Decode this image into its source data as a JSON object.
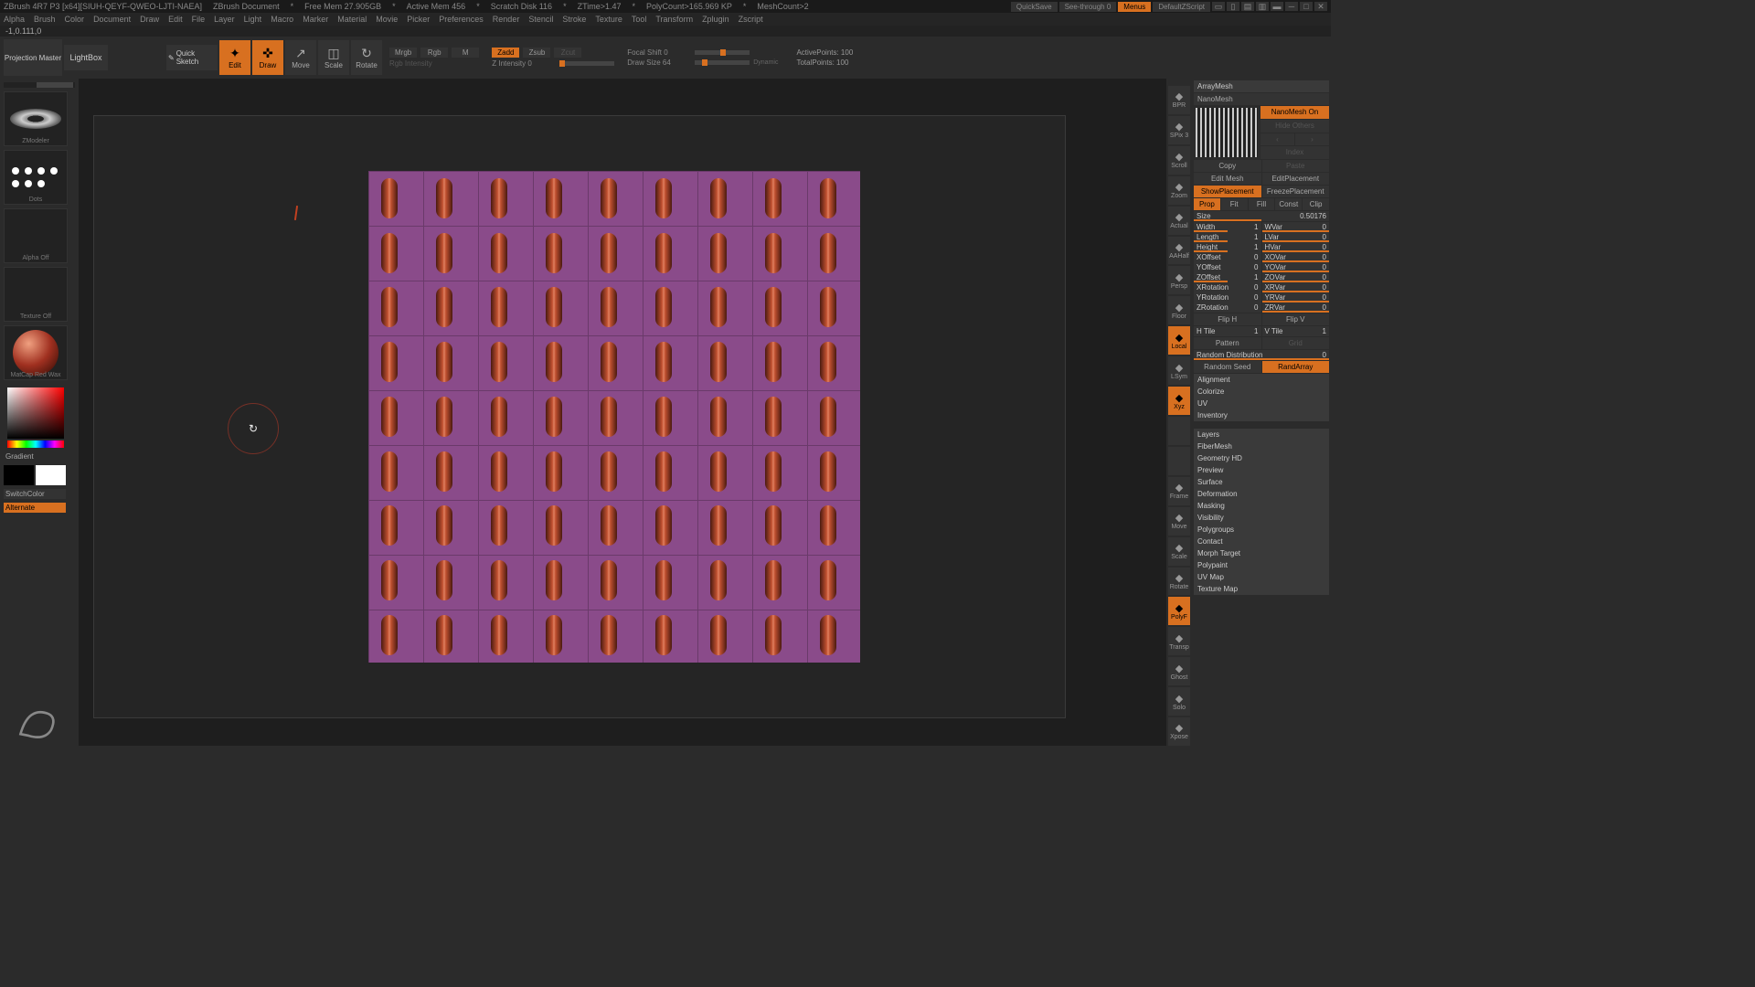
{
  "titlebar": {
    "app": "ZBrush 4R7 P3 [x64][SIUH-QEYF-QWEO-LJTI-NAEA]",
    "doc": "ZBrush Document",
    "mem": "Free Mem 27.905GB",
    "activemem": "Active Mem 456",
    "scratch": "Scratch Disk 116",
    "ztime": "ZTime>1.47",
    "polycount": "PolyCount>165.969 KP",
    "meshcount": "MeshCount>2",
    "quicksave": "QuickSave",
    "seethrough": "See-through  0",
    "menus": "Menus",
    "defaultscript": "DefaultZScript"
  },
  "menu": [
    "Alpha",
    "Brush",
    "Color",
    "Document",
    "Draw",
    "Edit",
    "File",
    "Layer",
    "Light",
    "Macro",
    "Marker",
    "Material",
    "Movie",
    "Picker",
    "Preferences",
    "Render",
    "Stencil",
    "Stroke",
    "Texture",
    "Tool",
    "Transform",
    "Zplugin",
    "Zscript"
  ],
  "status": "-1,0.111,0",
  "topbar": {
    "projection": "Projection Master",
    "lightbox": "LightBox",
    "quicksketch": "Quick Sketch",
    "modes": [
      "Edit",
      "Draw",
      "Move",
      "Scale",
      "Rotate"
    ],
    "mrgb": "Mrgb",
    "rgb": "Rgb",
    "m": "M",
    "rgbintensity": "Rgb Intensity",
    "zadd": "Zadd",
    "zsub": "Zsub",
    "zcut": "Zcut",
    "zintensity": "Z Intensity 0",
    "focalshift": "Focal Shift 0",
    "drawsize": "Draw Size 64",
    "dynamic": "Dynamic",
    "activepoints": "ActivePoints: 100",
    "totalpoints": "TotalPoints: 100"
  },
  "left": {
    "brush": "ZModeler",
    "stroke": "Dots",
    "alpha": "Alpha Off",
    "texture": "Texture Off",
    "material": "MatCap Red Wax",
    "gradient": "Gradient",
    "switchcolor": "SwitchColor",
    "alternate": "Alternate"
  },
  "righttools": [
    "BPR",
    "SPix 3",
    "Scroll",
    "Zoom",
    "Actual",
    "AAHalf",
    "Persp",
    "Floor",
    "Local",
    "LSym",
    "Xyz",
    "",
    "",
    "Frame",
    "Move",
    "Scale",
    "Rotate",
    "PolyF",
    "Transp",
    "Ghost",
    "Solo",
    "Xpose"
  ],
  "panel": {
    "arraymesh": "ArrayMesh",
    "nanomesh": "NanoMesh",
    "nanomesh_on": "NanoMesh On",
    "copy": "Copy",
    "paste": "Paste",
    "editmesh": "Edit Mesh",
    "editplacement": "EditPlacement",
    "showplacement": "ShowPlacement",
    "freezeplacement": "FreezePlacement",
    "prop": "Prop",
    "fit": "Fit",
    "fill": "Fill",
    "const": "Const",
    "clip": "Clip",
    "size": {
      "label": "Size",
      "val": "0.50176"
    },
    "params": [
      {
        "l": "Width",
        "lv": "1",
        "r": "WVar",
        "rv": "0"
      },
      {
        "l": "Length",
        "lv": "1",
        "r": "LVar",
        "rv": "0"
      },
      {
        "l": "Height",
        "lv": "1",
        "r": "HVar",
        "rv": "0"
      },
      {
        "l": "XOffset",
        "lv": "0",
        "r": "XOVar",
        "rv": "0"
      },
      {
        "l": "YOffset",
        "lv": "0",
        "r": "YOVar",
        "rv": "0"
      },
      {
        "l": "ZOffset",
        "lv": "1",
        "r": "ZOVar",
        "rv": "0"
      },
      {
        "l": "XRotation",
        "lv": "0",
        "r": "XRVar",
        "rv": "0"
      },
      {
        "l": "YRotation",
        "lv": "0",
        "r": "YRVar",
        "rv": "0"
      },
      {
        "l": "ZRotation",
        "lv": "0",
        "r": "ZRVar",
        "rv": "0"
      }
    ],
    "fliph": "Flip H",
    "flipv": "Flip V",
    "htile": {
      "l": "H Tile",
      "v": "1"
    },
    "vtile": {
      "l": "V Tile",
      "v": "1"
    },
    "pattern": "Pattern",
    "randomdist": {
      "l": "Random Distribution",
      "v": "0"
    },
    "randomseed": "Random Seed",
    "randarray": "RandArray",
    "sections": [
      "Alignment",
      "Colorize",
      "UV",
      "Inventory",
      "Layers",
      "FiberMesh",
      "Geometry HD",
      "Preview",
      "Surface",
      "Deformation",
      "Masking",
      "Visibility",
      "Polygroups",
      "Contact",
      "Morph Target",
      "Polypaint",
      "UV Map",
      "Texture Map"
    ]
  }
}
